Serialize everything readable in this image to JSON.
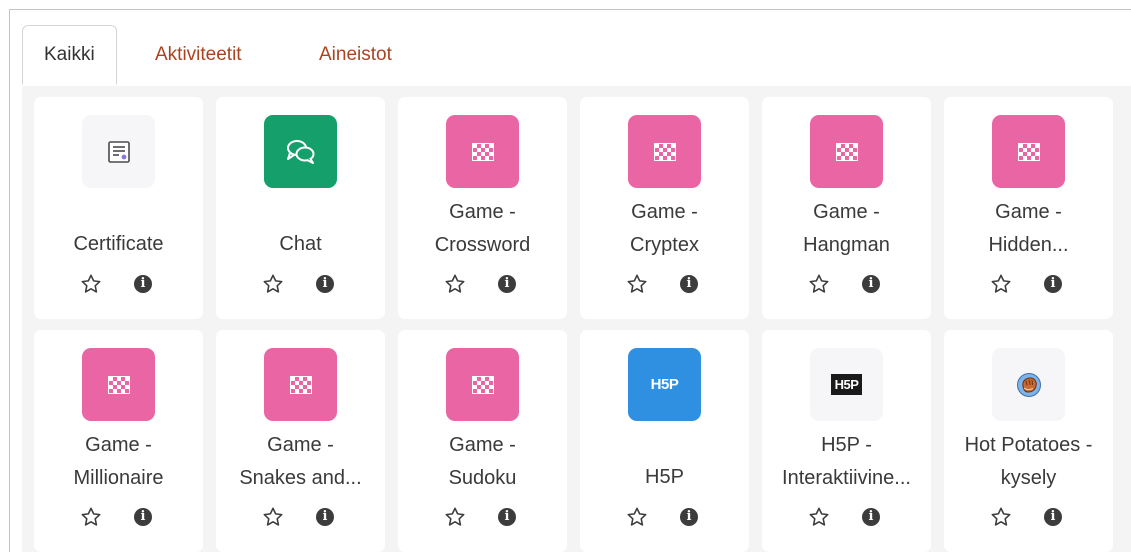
{
  "tabs": [
    {
      "label": "Kaikki",
      "active": true
    },
    {
      "label": "Aktiviteetit",
      "active": false
    },
    {
      "label": "Aineistot",
      "active": false
    }
  ],
  "colors": {
    "tab_link": "#a94420",
    "game_pink": "#ea65a3",
    "chat_green": "#15a06b",
    "h5p_blue": "#2f8fe1"
  },
  "modules": [
    {
      "lines": [
        "Certificate"
      ],
      "icon": "certificate-icon"
    },
    {
      "lines": [
        "Chat"
      ],
      "icon": "chat-icon"
    },
    {
      "lines": [
        "Game -",
        "Crossword"
      ],
      "icon": "game-icon"
    },
    {
      "lines": [
        "Game -",
        "Cryptex"
      ],
      "icon": "game-icon"
    },
    {
      "lines": [
        "Game -",
        "Hangman"
      ],
      "icon": "game-icon"
    },
    {
      "lines": [
        "Game -",
        "Hidden..."
      ],
      "icon": "game-icon"
    },
    {
      "lines": [
        "Game -",
        "Millionaire"
      ],
      "icon": "game-icon"
    },
    {
      "lines": [
        "Game -",
        "Snakes and..."
      ],
      "icon": "game-icon"
    },
    {
      "lines": [
        "Game -",
        "Sudoku"
      ],
      "icon": "game-icon"
    },
    {
      "lines": [
        "H5P"
      ],
      "icon": "h5p-icon",
      "icon_text": "H5P"
    },
    {
      "lines": [
        "H5P -",
        "Interaktiivine..."
      ],
      "icon": "h5p-interactive-icon",
      "icon_text": "H5P"
    },
    {
      "lines": [
        "Hot Potatoes -",
        "kysely"
      ],
      "icon": "hot-potatoes-icon"
    }
  ],
  "actions": {
    "info_glyph": "i"
  }
}
